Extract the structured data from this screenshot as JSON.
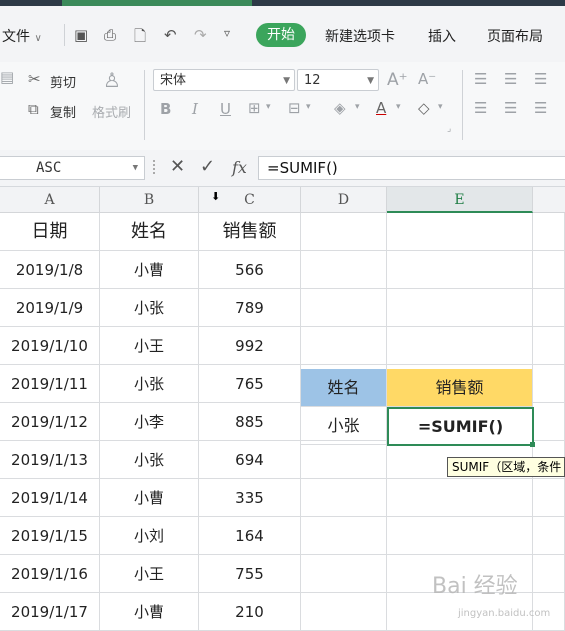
{
  "menu": {
    "file": "文件",
    "start": "开始",
    "new_tab": "新建选项卡",
    "insert": "插入",
    "page_layout": "页面布局"
  },
  "toolbar": {
    "cut": "剪切",
    "copy": "复制",
    "format_painter": "格式刷",
    "font_name": "宋体",
    "font_size": "12",
    "bold": "B",
    "italic": "I",
    "underline": "U"
  },
  "formula_bar": {
    "name_box": "ASC",
    "cancel": "✕",
    "confirm": "✓",
    "fx": "fx",
    "formula": "=SUMIF()"
  },
  "columns": [
    "A",
    "B",
    "C",
    "D",
    "E"
  ],
  "table": {
    "headers": [
      "日期",
      "姓名",
      "销售额"
    ],
    "rows": [
      [
        "2019/1/8",
        "小曹",
        "566"
      ],
      [
        "2019/1/9",
        "小张",
        "789"
      ],
      [
        "2019/1/10",
        "小王",
        "992"
      ],
      [
        "2019/1/11",
        "小张",
        "765"
      ],
      [
        "2019/1/12",
        "小李",
        "885"
      ],
      [
        "2019/1/13",
        "小张",
        "694"
      ],
      [
        "2019/1/14",
        "小曹",
        "335"
      ],
      [
        "2019/1/15",
        "小刘",
        "164"
      ],
      [
        "2019/1/16",
        "小王",
        "755"
      ],
      [
        "2019/1/17",
        "小曹",
        "210"
      ]
    ]
  },
  "lookup": {
    "name_header": "姓名",
    "sales_header": "销售额",
    "name_value": "小张",
    "formula_value": "=SUMIF()"
  },
  "tooltip": "SUMIF（区域，条件",
  "watermark": {
    "brand": "Bai 经验",
    "url": "jingyan.baidu.com"
  },
  "colors": {
    "accent_green": "#3ba55c",
    "selection_green": "#2e8b57",
    "blue_header": "#9dc3e6",
    "gold_header": "#ffd966"
  }
}
